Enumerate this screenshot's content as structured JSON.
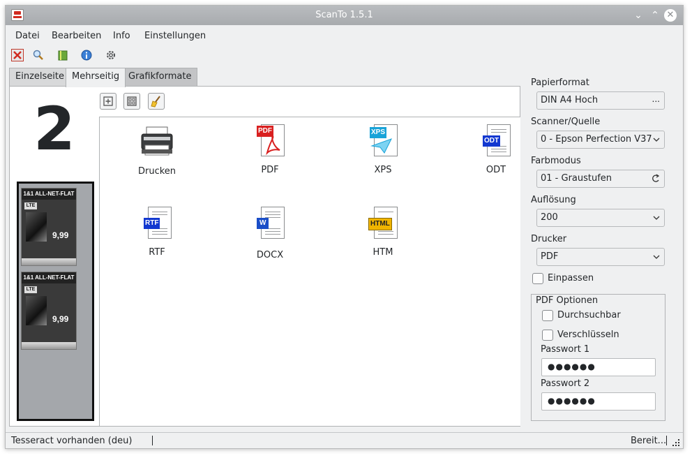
{
  "window": {
    "title": "ScanTo 1.5.1",
    "minimize": "⌄",
    "maximize": "⌃",
    "close": "✕"
  },
  "menu": {
    "items": [
      "Datei",
      "Bearbeiten",
      "Info",
      "Einstellungen"
    ]
  },
  "toolbar": {
    "icons": [
      "close-icon",
      "zoom-icon",
      "book-icon",
      "info-icon",
      "gear-icon"
    ]
  },
  "tabs": [
    "Einzelseite",
    "Mehrseitig",
    "Grafikformate"
  ],
  "active_tab": "Mehrseitig",
  "page_count": "2",
  "thumbnails": [
    {
      "header": "1&1 ALL-NET-FLAT",
      "badge": "LTE",
      "price": "9,99"
    },
    {
      "header": "1&1 ALL-NET-FLAT",
      "badge": "LTE",
      "price": "9,99"
    }
  ],
  "page_tools": {
    "add": "+",
    "arrange": "⊞",
    "clean": "🧹"
  },
  "formats": [
    {
      "label": "Drucken",
      "badge": ""
    },
    {
      "label": "PDF",
      "badge": "PDF",
      "color": "#d92020"
    },
    {
      "label": "XPS",
      "badge": "XPS",
      "color": "#19a3d8"
    },
    {
      "label": "ODT",
      "badge": "ODT",
      "color": "#1238d0"
    },
    {
      "label": "RTF",
      "badge": "RTF",
      "color": "#1238d0"
    },
    {
      "label": "DOCX",
      "badge": "W",
      "color": "#1a4ec8"
    },
    {
      "label": "HTM",
      "badge": "HTML",
      "color": "#f0b400"
    }
  ],
  "settings": {
    "paper_label": "Papierformat",
    "paper_value": "DIN A4 Hoch",
    "paper_suffix": "...",
    "scanner_label": "Scanner/Quelle",
    "scanner_value": "0 - Epson Perfection V37",
    "color_label": "Farbmodus",
    "color_value": "01 - Graustufen",
    "resolution_label": "Auflösung",
    "resolution_value": "200",
    "printer_label": "Drucker",
    "printer_value": "PDF",
    "fit_label": "Einpassen",
    "fit_checked": false
  },
  "pdf_options": {
    "title": "PDF Optionen",
    "searchable_label": "Durchsuchbar",
    "searchable_checked": false,
    "encrypt_label": "Verschlüsseln",
    "encrypt_checked": false,
    "password1_label": "Passwort 1",
    "password1_value": "●●●●●●",
    "password2_label": "Passwort 2",
    "password2_value": "●●●●●●"
  },
  "status": {
    "left": "Tesseract vorhanden (deu)",
    "right": "Bereit..."
  }
}
